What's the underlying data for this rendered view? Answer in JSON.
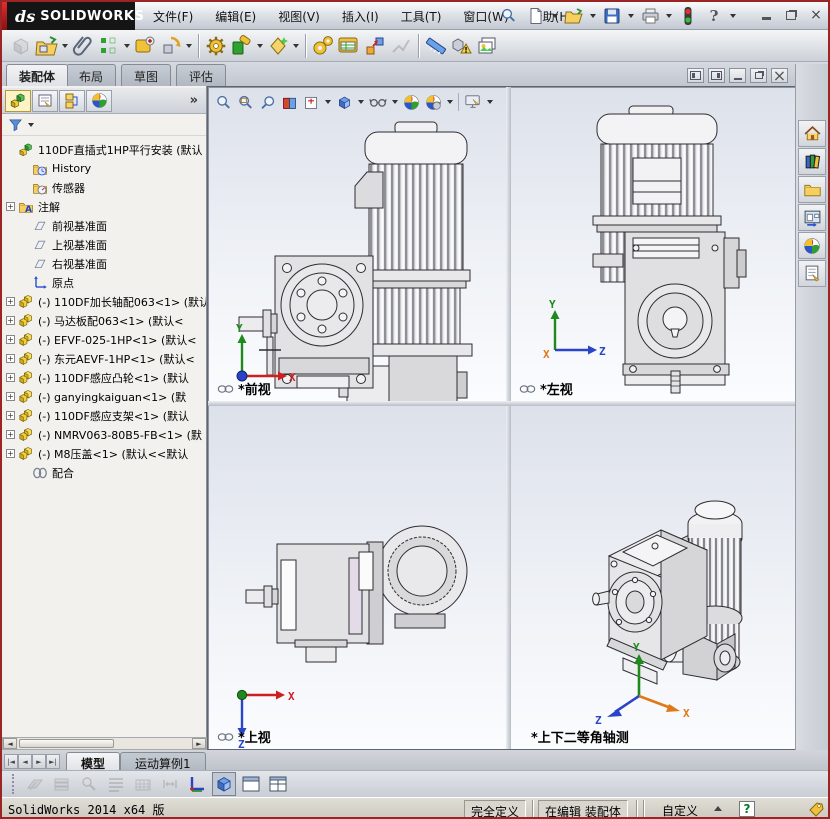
{
  "titlebar": {
    "logo_mark": "ds",
    "logo_text": "SOLIDWORKS",
    "menus": [
      "文件(F)",
      "编辑(E)",
      "视图(V)",
      "插入(I)",
      "工具(T)",
      "窗口(W)",
      "帮助(H)"
    ],
    "quick_icons": [
      "new-document",
      "open-document",
      "save",
      "print",
      "rebuild-traffic-light",
      "help"
    ],
    "window_buttons": [
      "minimize",
      "restore",
      "close"
    ]
  },
  "assembly_toolbar": {
    "icons": [
      "edit-component",
      "insert-components",
      "mate",
      "linear-component-pattern",
      "smart-fasteners",
      "move-component",
      "show-hidden-components",
      "assembly-features",
      "reference-geometry",
      "new-motion-study",
      "bill-of-materials",
      "exploded-view",
      "explode-line-sketch",
      "instant-3d",
      "large-assembly-mode",
      "take-snapshot"
    ]
  },
  "command_tabs": {
    "tabs": [
      {
        "label": "装配体",
        "active": true
      },
      {
        "label": "布局",
        "active": false
      },
      {
        "label": "草图",
        "active": false
      },
      {
        "label": "评估",
        "active": false
      }
    ]
  },
  "feature_panel": {
    "header_icons": [
      "feature-manager-tree",
      "property-manager",
      "configuration-manager",
      "display-manager"
    ],
    "overflow_glyph": "»",
    "tree": [
      {
        "icon": "assembly",
        "label": "110DF直插式1HP平行安装 (默认",
        "expandable": false
      },
      {
        "icon": "history-folder",
        "label": "History",
        "expandable": false
      },
      {
        "icon": "sensors-folder",
        "label": "传感器",
        "expandable": false
      },
      {
        "icon": "annotations-folder",
        "label": "注解",
        "expandable": true
      },
      {
        "icon": "plane",
        "label": "前视基准面",
        "expandable": false
      },
      {
        "icon": "plane",
        "label": "上视基准面",
        "expandable": false
      },
      {
        "icon": "plane",
        "label": "右视基准面",
        "expandable": false
      },
      {
        "icon": "origin",
        "label": "原点",
        "expandable": false
      },
      {
        "icon": "component",
        "label": "(-) 110DF加长轴配063<1> (默认<",
        "expandable": true
      },
      {
        "icon": "component",
        "label": "(-) 马达板配063<1> (默认<",
        "expandable": true
      },
      {
        "icon": "component",
        "label": "(-) EFVF-025-1HP<1> (默认<",
        "expandable": true
      },
      {
        "icon": "component",
        "label": "(-) 东元AEVF-1HP<1> (默认<",
        "expandable": true
      },
      {
        "icon": "component",
        "label": "(-) 110DF感应凸轮<1> (默认",
        "expandable": true
      },
      {
        "icon": "component",
        "label": "(-) ganyingkaiguan<1> (默",
        "expandable": true
      },
      {
        "icon": "component",
        "label": "(-) 110DF感应支架<1> (默认",
        "expandable": true
      },
      {
        "icon": "component",
        "label": "(-) NMRV063-80B5-FB<1> (默",
        "expandable": true
      },
      {
        "icon": "component",
        "label": "(-) M8压盖<1> (默认<<默认",
        "expandable": true
      },
      {
        "icon": "mates",
        "label": "配合",
        "expandable": false
      }
    ]
  },
  "heads_up_toolbar": {
    "icons": [
      "zoom-to-fit",
      "zoom-to-area",
      "magnifier-lens",
      "section-view",
      "view-orientation",
      "display-style",
      "hide-show-items",
      "edit-appearance",
      "apply-scene",
      "view-settings"
    ]
  },
  "viewport_window": {
    "controls": [
      "split-left",
      "split-right",
      "minimize",
      "restore",
      "close"
    ]
  },
  "viewports": [
    {
      "label": "*前视",
      "linked": true
    },
    {
      "label": "*左视",
      "linked": true
    },
    {
      "label": "*上视",
      "linked": true
    },
    {
      "label": "*上下二等角轴测",
      "linked": false
    }
  ],
  "task_pane": {
    "icons": [
      "solidworks-resources-home",
      "design-library",
      "file-explorer",
      "view-palette",
      "appearances-scenes",
      "custom-properties"
    ]
  },
  "motion_bar": {
    "tabs": [
      {
        "label": "模型",
        "active": true
      },
      {
        "label": "运动算例1",
        "active": false
      }
    ],
    "icons": [
      "assembly-visualization",
      "layer-properties",
      "hide-show-annotations",
      "filter-display",
      "grid-settings",
      "auto-key",
      "coordinate-system",
      "shaded-view",
      "single-viewport",
      "four-viewports"
    ]
  },
  "statusbar": {
    "app_version": "SolidWorks 2014 x64 版",
    "define_state": "完全定义",
    "edit_state": "在编辑 装配体",
    "display_state": "自定义"
  },
  "colors": {
    "window_border": "#9b2424",
    "viewport_gradient_top": "#dde1ea",
    "viewport_gradient_bottom": "#fbfcfe",
    "accent_yellow": "#f0c937",
    "accent_green": "#2fa12f",
    "accent_blue": "#2a4fd0",
    "accent_red": "#cc2222"
  }
}
